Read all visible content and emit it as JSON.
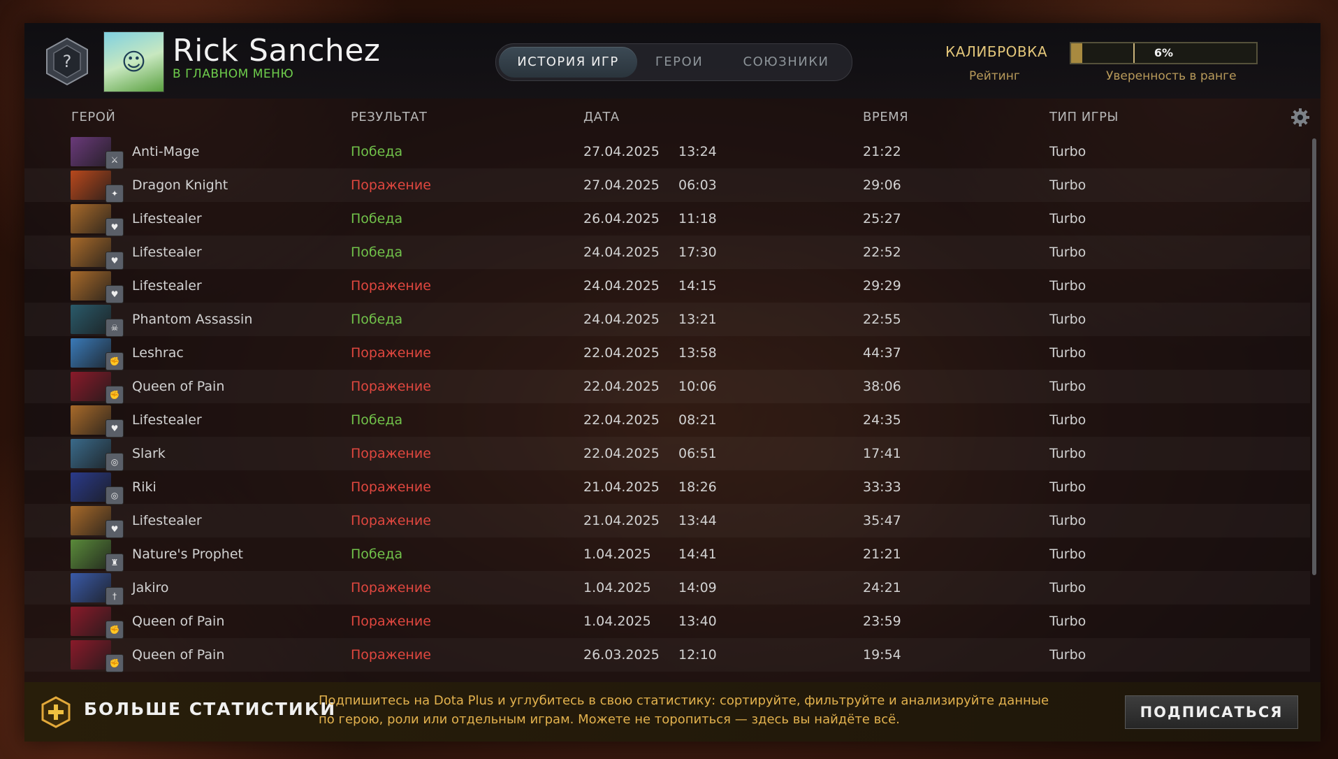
{
  "profile": {
    "name": "Rick Sanchez",
    "status": "В ГЛАВНОМ МЕНЮ"
  },
  "tabs": [
    {
      "label": "ИСТОРИЯ ИГР",
      "active": true
    },
    {
      "label": "ГЕРОИ",
      "active": false
    },
    {
      "label": "СОЮЗНИКИ",
      "active": false
    }
  ],
  "calibration": {
    "title": "КАЛИБРОВКА",
    "rating_label": "Рейтинг",
    "confidence_percent": 6,
    "confidence_text": "6%",
    "confidence_label": "Уверенность в ранге"
  },
  "columns": {
    "hero": "ГЕРОЙ",
    "result": "РЕЗУЛЬТАТ",
    "date": "ДАТА",
    "duration": "ВРЕМЯ",
    "game_type": "ТИП ИГРЫ"
  },
  "matches": [
    {
      "hero": "Anti-Mage",
      "result": "Победа",
      "win": true,
      "date": "27.04.2025",
      "time": "13:24",
      "duration": "21:22",
      "type": "Turbo",
      "color": "#6a3a7a",
      "role_icon": "agility-icon"
    },
    {
      "hero": "Dragon Knight",
      "result": "Поражение",
      "win": false,
      "date": "27.04.2025",
      "time": "06:03",
      "duration": "29:06",
      "type": "Turbo",
      "color": "#b8481c",
      "role_icon": "universal-icon"
    },
    {
      "hero": "Lifestealer",
      "result": "Победа",
      "win": true,
      "date": "26.04.2025",
      "time": "11:18",
      "duration": "25:27",
      "type": "Turbo",
      "color": "#a86a2a",
      "role_icon": "heart-icon"
    },
    {
      "hero": "Lifestealer",
      "result": "Победа",
      "win": true,
      "date": "24.04.2025",
      "time": "17:30",
      "duration": "22:52",
      "type": "Turbo",
      "color": "#a86a2a",
      "role_icon": "heart-icon"
    },
    {
      "hero": "Lifestealer",
      "result": "Поражение",
      "win": false,
      "date": "24.04.2025",
      "time": "14:15",
      "duration": "29:29",
      "type": "Turbo",
      "color": "#a86a2a",
      "role_icon": "heart-icon"
    },
    {
      "hero": "Phantom Assassin",
      "result": "Победа",
      "win": true,
      "date": "24.04.2025",
      "time": "13:21",
      "duration": "22:55",
      "type": "Turbo",
      "color": "#2a5a6a",
      "role_icon": "skull-icon"
    },
    {
      "hero": "Leshrac",
      "result": "Поражение",
      "win": false,
      "date": "22.04.2025",
      "time": "13:58",
      "duration": "44:37",
      "type": "Turbo",
      "color": "#3a7ab8",
      "role_icon": "fist-icon"
    },
    {
      "hero": "Queen of Pain",
      "result": "Поражение",
      "win": false,
      "date": "22.04.2025",
      "time": "10:06",
      "duration": "38:06",
      "type": "Turbo",
      "color": "#8a1a2a",
      "role_icon": "fist-icon"
    },
    {
      "hero": "Lifestealer",
      "result": "Победа",
      "win": true,
      "date": "22.04.2025",
      "time": "08:21",
      "duration": "24:35",
      "type": "Turbo",
      "color": "#a86a2a",
      "role_icon": "heart-icon"
    },
    {
      "hero": "Slark",
      "result": "Поражение",
      "win": false,
      "date": "22.04.2025",
      "time": "06:51",
      "duration": "17:41",
      "type": "Turbo",
      "color": "#3a6a8a",
      "role_icon": "swirl-icon"
    },
    {
      "hero": "Riki",
      "result": "Поражение",
      "win": false,
      "date": "21.04.2025",
      "time": "18:26",
      "duration": "33:33",
      "type": "Turbo",
      "color": "#2a3a8a",
      "role_icon": "swirl-icon"
    },
    {
      "hero": "Lifestealer",
      "result": "Поражение",
      "win": false,
      "date": "21.04.2025",
      "time": "13:44",
      "duration": "35:47",
      "type": "Turbo",
      "color": "#a86a2a",
      "role_icon": "heart-icon"
    },
    {
      "hero": "Nature's Prophet",
      "result": "Победа",
      "win": true,
      "date": "1.04.2025",
      "time": "14:41",
      "duration": "21:21",
      "type": "Turbo",
      "color": "#5a8a3a",
      "role_icon": "tower-icon"
    },
    {
      "hero": "Jakiro",
      "result": "Поражение",
      "win": false,
      "date": "1.04.2025",
      "time": "14:09",
      "duration": "24:21",
      "type": "Turbo",
      "color": "#3a5aa8",
      "role_icon": "dagger-icon"
    },
    {
      "hero": "Queen of Pain",
      "result": "Поражение",
      "win": false,
      "date": "1.04.2025",
      "time": "13:40",
      "duration": "23:59",
      "type": "Turbo",
      "color": "#8a1a2a",
      "role_icon": "fist-icon"
    },
    {
      "hero": "Queen of Pain",
      "result": "Поражение",
      "win": false,
      "date": "26.03.2025",
      "time": "12:10",
      "duration": "19:54",
      "type": "Turbo",
      "color": "#8a1a2a",
      "role_icon": "fist-icon"
    }
  ],
  "footer": {
    "title": "БОЛЬШЕ СТАТИСТИКИ",
    "promo_text": "Подпишитесь на Dota Plus и углубитесь в свою статистику: сортируйте, фильтруйте и анализируйте данные по герою, роли или отдельным играм. Можете не торопиться — здесь вы найдёте всё.",
    "subscribe_label": "ПОДПИСАТЬСЯ"
  },
  "colors": {
    "win": "#71c24a",
    "loss": "#e0473f",
    "accent_gold": "#e3c67a",
    "status_green": "#6fce4c"
  }
}
